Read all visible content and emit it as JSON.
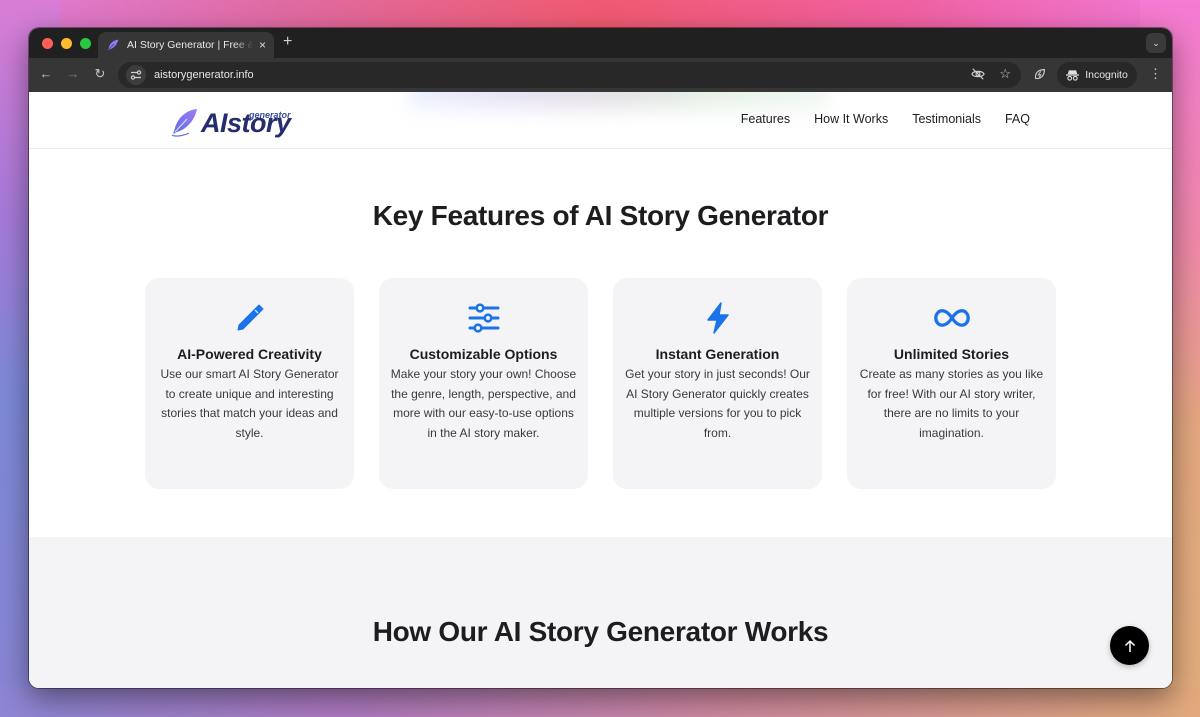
{
  "browser": {
    "tab": {
      "title": "AI Story Generator | Free & No Sign-up",
      "close_icon": "×"
    },
    "new_tab_icon": "+",
    "tab_search_icon": "⌄",
    "url": "aistorygenerator.info",
    "nav": {
      "back_icon": "←",
      "forward_icon": "→",
      "reload_icon": "↻"
    },
    "incognito_label": "Incognito",
    "menu_icon": "⋮",
    "bookmark_icon": "☆"
  },
  "site": {
    "logo": {
      "main": "AIstory",
      "sub": "generator"
    },
    "nav": [
      {
        "label": "Features"
      },
      {
        "label": "How It Works"
      },
      {
        "label": "Testimonials"
      },
      {
        "label": "FAQ"
      }
    ],
    "features": {
      "title": "Key Features of AI Story Generator",
      "cards": [
        {
          "icon": "pen-icon",
          "title": "AI-Powered Creativity",
          "description": "Use our smart AI Story Generator to create unique and interesting stories that match your ideas and style."
        },
        {
          "icon": "sliders-icon",
          "title": "Customizable Options",
          "description": "Make your story your own! Choose the genre, length, perspective, and more with our easy-to-use options in the AI story maker."
        },
        {
          "icon": "lightning-icon",
          "title": "Instant Generation",
          "description": "Get your story in just seconds! Our AI Story Generator quickly creates multiple versions for you to pick from."
        },
        {
          "icon": "infinity-icon",
          "title": "Unlimited Stories",
          "description": "Create as many stories as you like for free! With our AI story writer, there are no limits to your imagination."
        }
      ]
    },
    "how_it_works": {
      "title": "How Our AI Story Generator Works"
    },
    "scroll_top_icon": "↑"
  },
  "colors": {
    "accent": "#1a73e8",
    "logo_navy": "#252d6e",
    "card_bg": "#f4f4f7",
    "chrome_dark": "#202020"
  }
}
